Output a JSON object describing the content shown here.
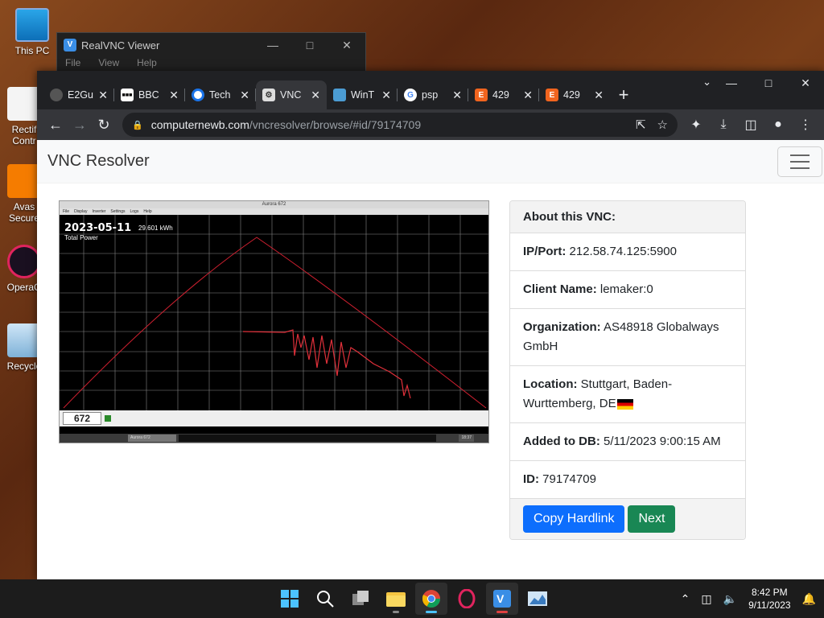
{
  "desktop": {
    "icons": [
      {
        "label": "This PC"
      },
      {
        "label": "Rectif\nContr"
      },
      {
        "label": "Avas\nSecure"
      },
      {
        "label": "OperaG"
      },
      {
        "label": "Recycle"
      }
    ]
  },
  "vnc_viewer": {
    "title": "RealVNC Viewer",
    "menu": [
      "File",
      "View",
      "Help"
    ]
  },
  "browser": {
    "tabs": [
      {
        "label": "E2Gu",
        "icon": "globe-icon",
        "active": false
      },
      {
        "label": "BBC",
        "icon": "bbc-icon",
        "active": false
      },
      {
        "label": "Tech",
        "icon": "tech-icon",
        "active": false
      },
      {
        "label": "VNC",
        "icon": "vnc-icon",
        "active": true
      },
      {
        "label": "WinT",
        "icon": "wint-icon",
        "active": false
      },
      {
        "label": "psp",
        "icon": "google-icon",
        "active": false
      },
      {
        "label": "429",
        "icon": "etsy-icon",
        "active": false
      },
      {
        "label": "429",
        "icon": "etsy-icon",
        "active": false
      }
    ],
    "url_host": "computernewb.com",
    "url_path": "/vncresolver/browse/#id/79174709"
  },
  "page": {
    "brand": "VNC Resolver",
    "screenshot": {
      "window_title": "Aurora 672",
      "menu": [
        "File",
        "Display",
        "Inverter",
        "Settings",
        "Logs",
        "Help"
      ],
      "date": "2023-05-11",
      "kwh": "29.601 kWh",
      "series_label": "Total Power",
      "inverter_num": "672",
      "taskbar_item": "Aurora 672",
      "clock": "18:37"
    },
    "card": {
      "header": "About this VNC:",
      "ip_label": "IP/Port:",
      "ip_value": "212.58.74.125:5900",
      "client_label": "Client Name:",
      "client_value": "lemaker:0",
      "org_label": "Organization:",
      "org_value": "AS48918 Globalways GmbH",
      "loc_label": "Location:",
      "loc_value": "Stuttgart, Baden-Wurttemberg, DE",
      "added_label": "Added to DB:",
      "added_value": "5/11/2023 9:00:15 AM",
      "id_label": "ID:",
      "id_value": "79174709",
      "copy_button": "Copy Hardlink",
      "next_button": "Next"
    }
  },
  "taskbar": {
    "time": "8:42 PM",
    "date": "9/11/2023"
  },
  "colors": {
    "primary": "#0d6efd",
    "success": "#198754",
    "plot_line": "#e0303a"
  }
}
